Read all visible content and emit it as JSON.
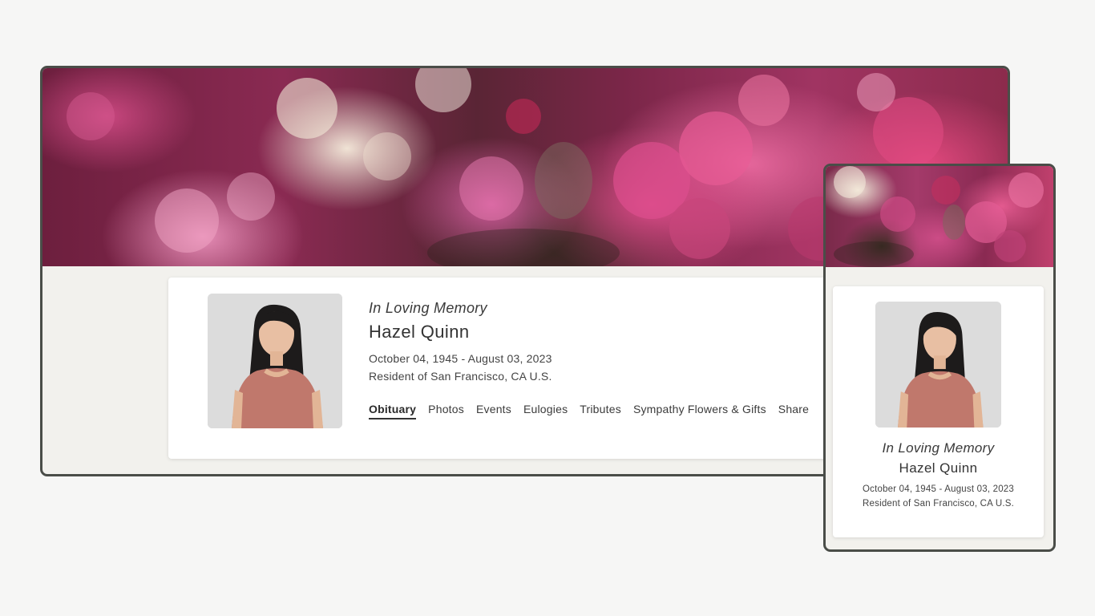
{
  "memorial": {
    "heading": "In Loving Memory",
    "name": "Hazel Quinn",
    "dates": "October 04, 1945 - August 03, 2023",
    "residence": "Resident of San Francisco, CA U.S."
  },
  "tabs": [
    {
      "label": "Obituary",
      "active": true
    },
    {
      "label": "Photos",
      "active": false
    },
    {
      "label": "Events",
      "active": false
    },
    {
      "label": "Eulogies",
      "active": false
    },
    {
      "label": "Tributes",
      "active": false
    },
    {
      "label": "Sympathy Flowers & Gifts",
      "active": false
    },
    {
      "label": "Share",
      "active": false
    }
  ],
  "colors": {
    "frame_border": "#4a4d48",
    "page_background": "#f6f6f5",
    "card_background": "#ffffff",
    "frame_background": "#f2f1ed"
  }
}
